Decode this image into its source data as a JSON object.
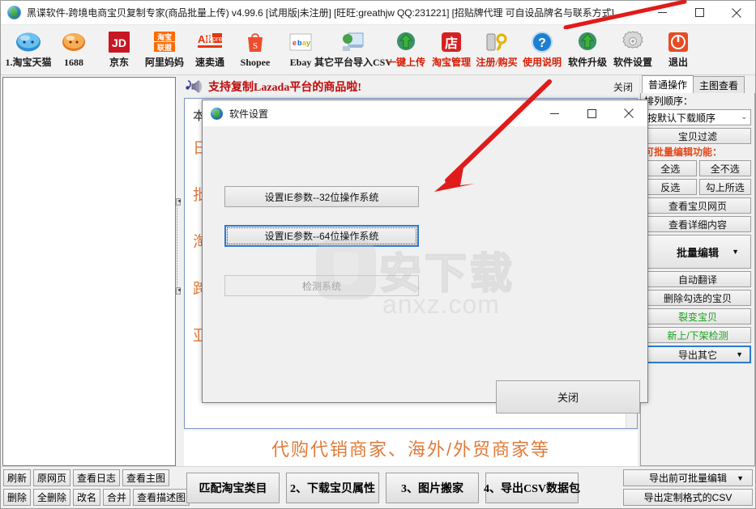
{
  "window": {
    "title": "黑谍软件-跨境电商宝贝复制专家(商品批量上传)  v4.99.6 [试用版|未注册] [旺旺:greathjw QQ:231221] [招贴牌代理 可自设品牌名与联系方式]",
    "icon": "app-globe-icon",
    "minimize": "–",
    "maximize": "□",
    "close": "✕"
  },
  "toolbar": {
    "items": [
      {
        "label": "1.淘宝天猫",
        "icon": "taobao-tmall-icon",
        "color": "dark"
      },
      {
        "label": "1688",
        "icon": "alibaba-1688-icon",
        "color": "dark"
      },
      {
        "label": "京东",
        "icon": "jd-icon",
        "color": "dark"
      },
      {
        "label": "阿里妈妈",
        "icon": "alimama-icon",
        "color": "dark"
      },
      {
        "label": "速卖通",
        "icon": "aliexpress-icon",
        "color": "dark"
      },
      {
        "label": "Shopee",
        "icon": "shopee-icon",
        "color": "dark"
      },
      {
        "label": "Ebay",
        "icon": "ebay-icon",
        "color": "dark"
      },
      {
        "label": "其它平台导入CSV",
        "icon": "import-csv-icon",
        "color": "dark"
      },
      {
        "label": "一键上传",
        "icon": "upload-icon",
        "color": "red"
      },
      {
        "label": "淘宝管理",
        "icon": "shop-icon",
        "color": "red"
      },
      {
        "label": "注册/购买",
        "icon": "key-icon",
        "color": "red"
      },
      {
        "label": "使用说明",
        "icon": "help-icon",
        "color": "red"
      },
      {
        "label": "软件升级",
        "icon": "upgrade-icon",
        "color": "dark"
      },
      {
        "label": "软件设置",
        "icon": "gear-icon",
        "color": "dark"
      },
      {
        "label": "退出",
        "icon": "power-icon",
        "color": "dark"
      }
    ]
  },
  "notice": {
    "text": "支持复制Lazada平台的商品啦!",
    "close_label": "关闭",
    "icon": "speaker-icon"
  },
  "promo": {
    "lines": [
      "本软件适合：",
      "日常采集商品的卖家",
      "批量复制商品的卖家",
      "淘宝/天猫/拼多多卖家",
      "跨境电商卖家",
      "亚马逊/虾皮/Lazada卖家",
      "代购代销商家、海外/外贸商家等"
    ],
    "banner": "代购代销商家、海外/外贸商家等"
  },
  "sidebar": {
    "tabs": [
      {
        "label": "普通操作",
        "active": true
      },
      {
        "label": "主图查看",
        "active": false
      }
    ],
    "sort_label": "排列顺序：",
    "sort_value": "按默认下载顺序",
    "filter_button": "宝贝过滤",
    "batch_header": "可批量编辑功能：",
    "select_all": "全选",
    "select_none": "全不选",
    "invert": "反选",
    "check_selected": "勾上所选",
    "view_page": "查看宝贝网页",
    "view_detail": "查看详细内容",
    "batch_edit": "批量编辑",
    "auto_translate": "自动翻译",
    "delete_checked": "删除勾选的宝贝",
    "split_item": "裂变宝贝",
    "shelf_check": "新上/下架检测",
    "export_other": "导出其它",
    "caret": "▼"
  },
  "bottom": {
    "left_row1": [
      "刷新",
      "原网页",
      "查看日志",
      "查看主图"
    ],
    "left_row2": [
      "删除",
      "全删除",
      "改名",
      "合并",
      "查看描述图"
    ],
    "center": [
      "匹配淘宝类目",
      "2、下载宝贝属性",
      "3、图片搬家",
      "4、导出CSV数据包"
    ],
    "right": [
      "导出前可批量编辑",
      "导出定制格式的CSV"
    ],
    "caret": "▼"
  },
  "dialog": {
    "title": "软件设置",
    "icon": "app-globe-icon",
    "minimize": "–",
    "maximize": "□",
    "close": "✕",
    "btn_ie32": "设置IE参数--32位操作系统",
    "btn_ie64": "设置IE参数--64位操作系统",
    "btn_detect": "检测系统",
    "btn_close": "关闭"
  },
  "watermark": {
    "cn": "安下载",
    "en": "anxz.com"
  },
  "colors": {
    "accent_red": "#c20a0a",
    "toolbar_red": "#d81e06",
    "orange": "#e07b39",
    "focus_blue": "#2b7ad1",
    "green": "#1aa01a",
    "annotation_red": "#e01b1b"
  }
}
